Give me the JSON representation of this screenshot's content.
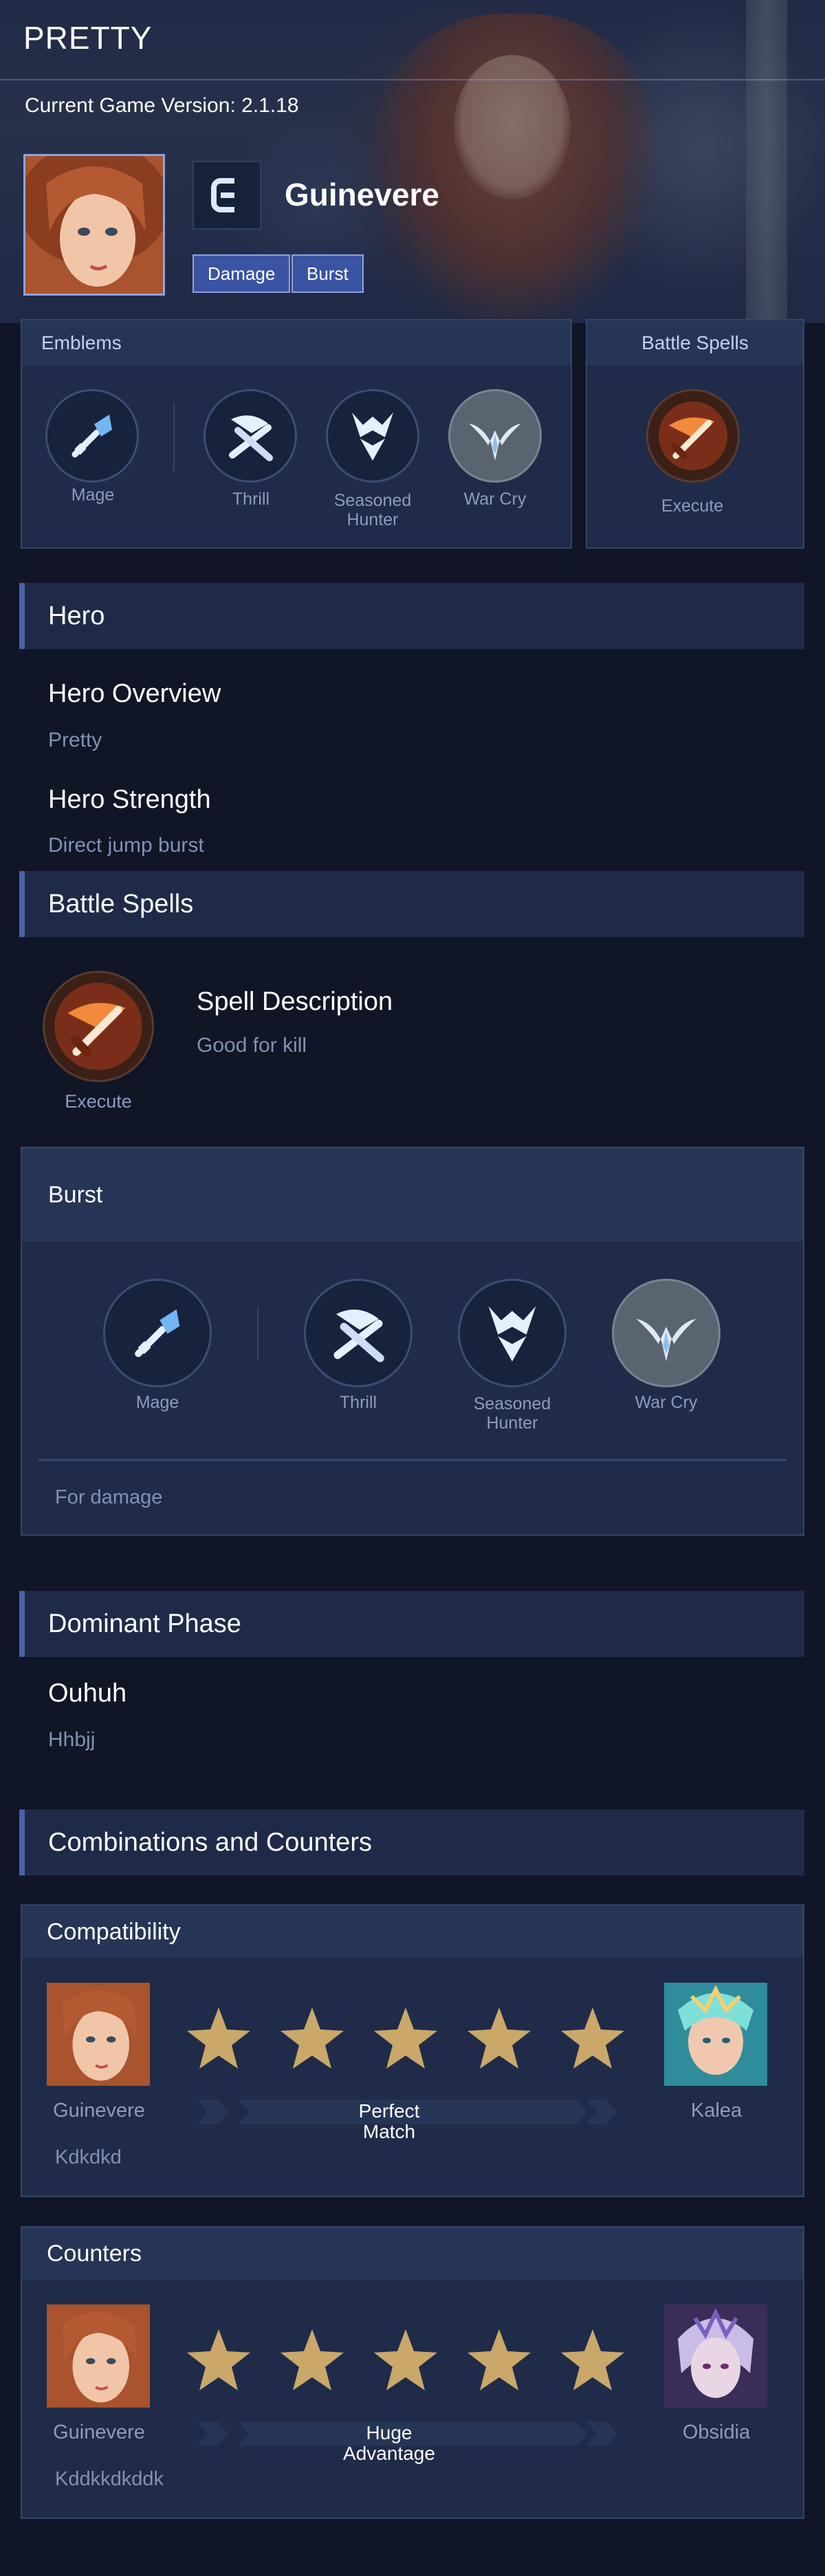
{
  "page": {
    "title": "PRETTY",
    "version_text": "Current Game Version: 2.1.18"
  },
  "hero": {
    "name": "Guinevere",
    "tags": [
      "Damage",
      "Burst"
    ]
  },
  "emblems_panel": {
    "title": "Emblems",
    "items": [
      {
        "label": "Mage",
        "icon": "staff-icon"
      },
      {
        "label": "Thrill",
        "icon": "crossed-blades-icon"
      },
      {
        "label": "Seasoned Hunter",
        "icon": "horned-helm-icon"
      },
      {
        "label": "War Cry",
        "icon": "winged-crest-icon"
      }
    ]
  },
  "spell_panel": {
    "title": "Battle Spells",
    "item": {
      "label": "Execute",
      "icon": "flaming-sword-icon"
    }
  },
  "sections": {
    "hero": "Hero",
    "battle_spells": "Battle Spells",
    "dominant_phase": "Dominant Phase",
    "combos": "Combinations and Counters"
  },
  "hero_info": {
    "overview_title": "Hero Overview",
    "overview_text": "Pretty",
    "strength_title": "Hero Strength",
    "strength_text": "Direct jump burst"
  },
  "spell_info": {
    "label": "Execute",
    "desc_title": "Spell Description",
    "desc_text": "Good for kill"
  },
  "build_card": {
    "title": "Burst",
    "items": [
      {
        "label": "Mage"
      },
      {
        "label": "Thrill"
      },
      {
        "label": "Seasoned Hunter"
      },
      {
        "label": "War Cry"
      }
    ],
    "note": "For damage"
  },
  "dominant_phase": {
    "title": "Ouhuh",
    "text": "Hhbjj"
  },
  "compatibility": {
    "title": "Compatibility",
    "left_hero": "Guinevere",
    "right_hero": "Kalea",
    "rating_stars": 5,
    "rating_text": "Perfect Match",
    "note": "Kdkdkd"
  },
  "counters": {
    "title": "Counters",
    "left_hero": "Guinevere",
    "right_hero": "Obsidia",
    "rating_stars": 5,
    "rating_text": "Huge Advantage",
    "note": "Kddkkdkddk"
  },
  "colors": {
    "background": "#101626",
    "panel": "#1e2a48",
    "accent": "#4a62a6",
    "tag": "#3a53a3",
    "star": "#c9a86a"
  }
}
